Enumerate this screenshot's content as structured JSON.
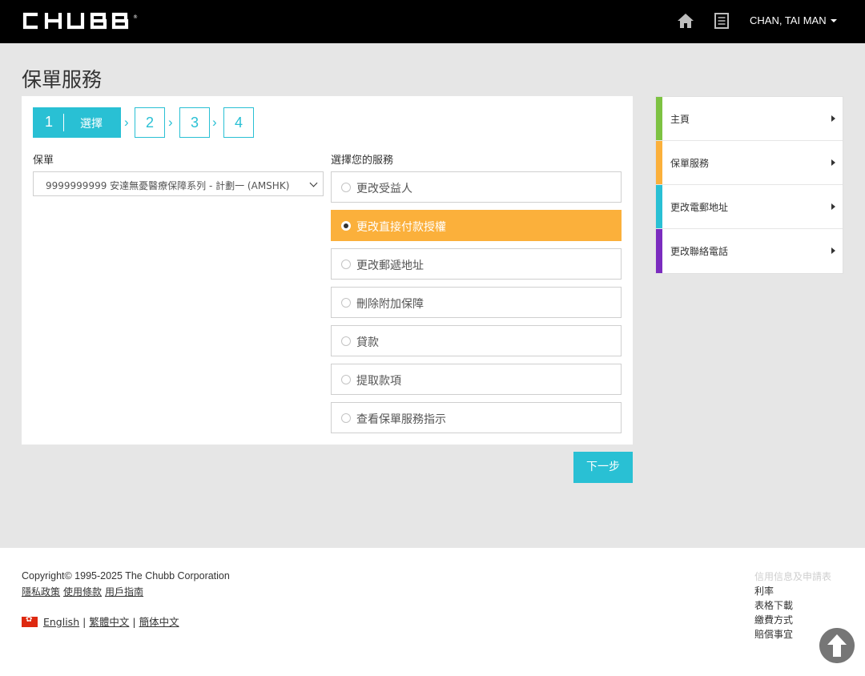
{
  "header": {
    "logo_text": "CHUBB",
    "user_name": "CHAN, TAI MAN",
    "home_icon": "home-icon",
    "doc_icon": "document-list-icon"
  },
  "page": {
    "title": "保單服務"
  },
  "stepper": {
    "active_number": "1",
    "active_label": "選擇",
    "steps": [
      "2",
      "3",
      "4"
    ],
    "separator": "›"
  },
  "form": {
    "policy_label": "保單",
    "policy_value": "9999999999 安達無憂醫療保障系列 - 計劃一 (AMSHK)",
    "service_label": "選擇您的服務",
    "options": [
      {
        "label": "更改受益人",
        "selected": false
      },
      {
        "label": "更改直接付款授權",
        "selected": true
      },
      {
        "label": "更改郵遞地址",
        "selected": false
      },
      {
        "label": "刪除附加保障",
        "selected": false
      },
      {
        "label": "貸款",
        "selected": false
      },
      {
        "label": "提取款項",
        "selected": false
      },
      {
        "label": "查看保單服務指示",
        "selected": false
      }
    ],
    "next_label": "下一步"
  },
  "sidenav": {
    "items": [
      {
        "label": "主頁",
        "color": "#7dc242"
      },
      {
        "label": "保單服務",
        "color": "#fbb03b"
      },
      {
        "label": "更改電郵地址",
        "color": "#29c0d4"
      },
      {
        "label": "更改聯絡電話",
        "color": "#7b2cbf"
      }
    ]
  },
  "footer": {
    "copyright": "Copyright© 1995-2025 The Chubb Corporation",
    "links": [
      "隱私政策",
      "使用條款",
      "用戶指南"
    ],
    "languages": [
      "English",
      "繁體中文",
      "簡体中文"
    ],
    "right_links": [
      "信用信息及申請表",
      "利率",
      "表格下載",
      "繳費方式",
      "賠償事宜"
    ]
  },
  "colors": {
    "accent": "#29c0d4",
    "selected": "#fbb03b",
    "header_bg": "#000000",
    "band_bg": "#e6e6e6"
  }
}
